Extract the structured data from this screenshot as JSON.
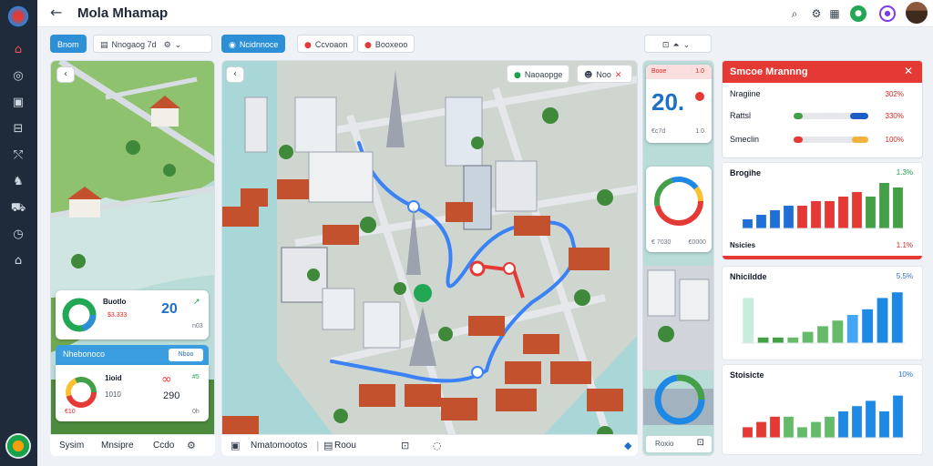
{
  "app": {
    "title": "Mola Mhamap"
  },
  "colors": {
    "accent_blue": "#2d8fd5",
    "accent_red": "#e53935",
    "sidebar": "#1f2a3a",
    "green": "#22a855"
  },
  "sidebar": {
    "icons": [
      "home-icon",
      "compass-icon",
      "image-icon",
      "inbox-icon",
      "route-icon",
      "walk-icon",
      "truck-icon",
      "clock-icon",
      "bank-icon"
    ]
  },
  "toolbar": {
    "left_primary": "Bnom",
    "left_chip": "Nnogaog 7d",
    "mid_primary": "Ncidnnoce",
    "mid_chip1": "Ccvoaon",
    "mid_chip2": "Booxeoo"
  },
  "map_overlay": {
    "search_label": "Naoaopge",
    "tag_label": "Noo"
  },
  "left_panel": {
    "card1": {
      "title": "Buotlo",
      "value": "20",
      "sub1": "$3.333",
      "sub2": "n03"
    },
    "header_label": "Nhebonoco",
    "header_btn": "Nboo",
    "card2": {
      "title": "1ioid",
      "value": "290",
      "sub1": "1010",
      "sub2": "#5",
      "sub3": "€10",
      "sub4": "0h"
    }
  },
  "kpi": {
    "label": "Booe",
    "pct": "1.0",
    "value": "20.",
    "sub1": "€c7d",
    "sub2": "1.0"
  },
  "donut_card": {
    "sub1": "€ 7030",
    "sub2": "€0000"
  },
  "stats_panel": {
    "title": "Smcoe Mrannng",
    "rows": [
      {
        "label": "Nragiine",
        "pct": "302%"
      },
      {
        "label": "Rattsl",
        "pct": "330%"
      },
      {
        "label": "Smeclin",
        "pct": "100%"
      }
    ]
  },
  "chart_data": [
    {
      "type": "bar",
      "title": "Brogihe",
      "pct_label": "1.3%",
      "pct_color": "#16a34a",
      "sub_label": "Nsicies",
      "sub_pct": "1.1%",
      "values": [
        2,
        3,
        4,
        5,
        5,
        6,
        6,
        7,
        8,
        7,
        10,
        9
      ],
      "colors": [
        "#1f6fd6",
        "#1f6fd6",
        "#1f6fd6",
        "#1f6fd6",
        "#e53935",
        "#e53935",
        "#e53935",
        "#e53935",
        "#e53935",
        "#43a047",
        "#43a047",
        "#43a047"
      ],
      "ylim": [
        0,
        10
      ]
    },
    {
      "type": "bar",
      "title": "Nhicildde",
      "pct_label": "5.5%",
      "pct_color": "#2d6fd6",
      "values": [
        8,
        1,
        1,
        1,
        2,
        3,
        4,
        5,
        6,
        8,
        9
      ],
      "colors": [
        "#c8eddc",
        "#43a047",
        "#43a047",
        "#66bb6a",
        "#66bb6a",
        "#66bb6a",
        "#66bb6a",
        "#42a5f5",
        "#1e88e5",
        "#1e88e5",
        "#1e88e5"
      ],
      "ylim": [
        0,
        10
      ]
    },
    {
      "type": "bar",
      "title": "Stoisicte",
      "pct_label": "10%",
      "pct_color": "#2d6fd6",
      "values": [
        2,
        3,
        4,
        4,
        2,
        3,
        4,
        5,
        6,
        7,
        5,
        8
      ],
      "colors": [
        "#e53935",
        "#e53935",
        "#e53935",
        "#66bb6a",
        "#66bb6a",
        "#66bb6a",
        "#66bb6a",
        "#1e88e5",
        "#1e88e5",
        "#1e88e5",
        "#1e88e5",
        "#1e88e5"
      ],
      "ylim": [
        0,
        10
      ]
    }
  ],
  "bottombar": {
    "left1": "Sysim",
    "left2": "Mnsipre",
    "left3": "Ccdo",
    "mid1": "Nmatomootos",
    "mid2": "Roou",
    "right1": "Roxio"
  }
}
